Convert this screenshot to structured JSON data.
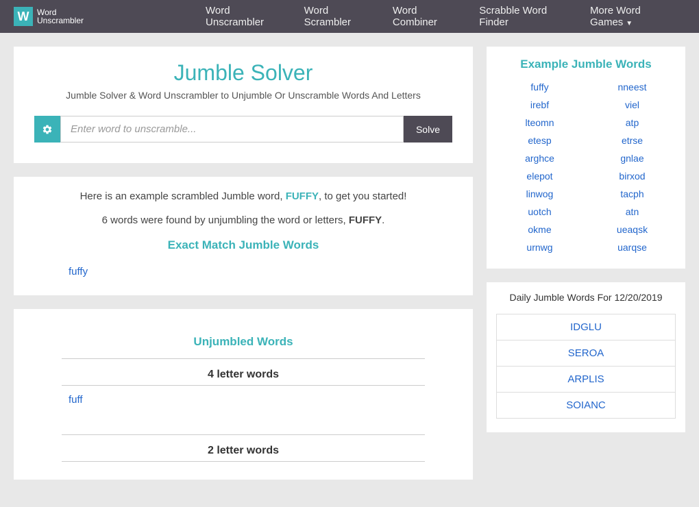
{
  "nav": {
    "brand_line1": "Word",
    "brand_line2": "Unscrambler",
    "items": [
      {
        "label": "Word Unscrambler"
      },
      {
        "label": "Word Scrambler"
      },
      {
        "label": "Word Combiner"
      },
      {
        "label": "Scrabble Word Finder"
      },
      {
        "label": "More Word Games",
        "caret": true
      }
    ]
  },
  "hero": {
    "title": "Jumble Solver",
    "subtitle": "Jumble Solver & Word Unscrambler to Unjumble Or Unscramble Words And Letters",
    "placeholder": "Enter word to unscramble...",
    "solve_label": "Solve"
  },
  "results": {
    "intro_prefix": "Here is an example scrambled Jumble word, ",
    "intro_word": "FUFFY",
    "intro_suffix": ", to get you started!",
    "count_line_prefix": "6 words were found by unjumbling the word or letters, ",
    "count_line_word": "FUFFY",
    "count_line_suffix": ".",
    "exact_title": "Exact Match Jumble Words",
    "exact_words": [
      "fuffy"
    ],
    "unjumbled_title": "Unjumbled Words",
    "groups": [
      {
        "title": "4 letter words",
        "words": [
          "fuff"
        ]
      },
      {
        "title": "2 letter words",
        "words": []
      }
    ]
  },
  "sidebar": {
    "examples_title": "Example Jumble Words",
    "examples": [
      [
        "fuffy",
        "nneest"
      ],
      [
        "irebf",
        "viel"
      ],
      [
        "lteomn",
        "atp"
      ],
      [
        "etesp",
        "etrse"
      ],
      [
        "arghce",
        "gnlae"
      ],
      [
        "elepot",
        "birxod"
      ],
      [
        "linwog",
        "tacph"
      ],
      [
        "uotch",
        "atn"
      ],
      [
        "okme",
        "ueaqsk"
      ],
      [
        "urnwg",
        "uarqse"
      ]
    ],
    "daily_title": "Daily Jumble Words For 12/20/2019",
    "daily_words": [
      "IDGLU",
      "SEROA",
      "ARPLIS",
      "SOIANC"
    ]
  }
}
